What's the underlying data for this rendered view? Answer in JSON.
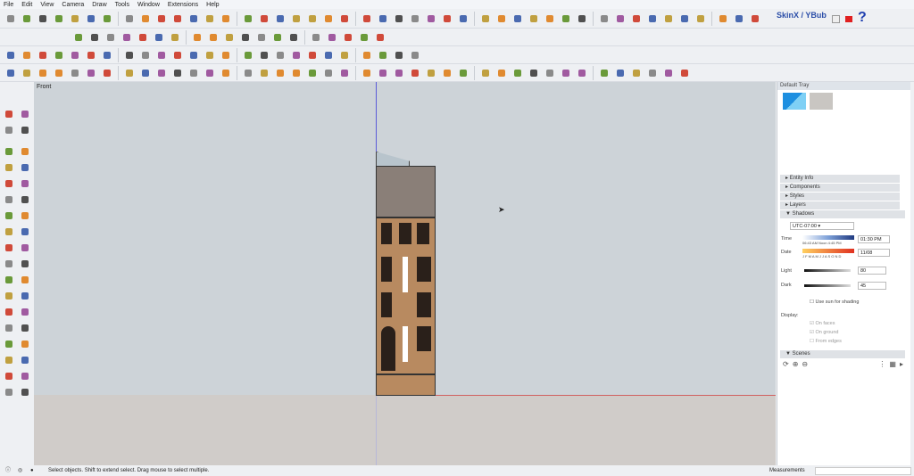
{
  "menu": [
    "File",
    "Edit",
    "View",
    "Camera",
    "Draw",
    "Tools",
    "Window",
    "Extensions",
    "Help"
  ],
  "toolbars": {
    "row1": [
      "orbit-icon",
      "play-icon",
      "stop-icon",
      "rewind-icon",
      "stamp-icon",
      "pushpin-icon",
      "drape-icon",
      "polyline-icon",
      "weld-icon",
      "scissors-icon",
      "cloud-icon",
      "cloud-icon",
      "curve-icon",
      "curve-icon",
      "curve-icon",
      "bezier-icon",
      "fillet-icon",
      "corner-icon",
      "arc-icon",
      "arc-icon",
      "chamfer-icon",
      "grid-icon",
      "grid-icon",
      "shape-icon",
      "shape-icon",
      "shape-icon",
      "shape-icon",
      "arrow-icon",
      "arrow-icon",
      "arrow-icon",
      "grid-icon",
      "grid-icon",
      "grid-icon",
      "grid-icon",
      "grid-icon",
      "grid-icon",
      "grid-icon",
      "grid-icon",
      "grid-icon",
      "grid-icon",
      "sphere-icon",
      "sphere-icon",
      "sphere-icon",
      "cloud-icon",
      "extrude-icon"
    ],
    "row2": [
      "extrude-icon",
      "extrude-icon",
      "extrude-icon",
      "extrude-icon",
      "extrude-icon",
      "extrude-icon",
      "extrude-icon",
      "extrude-icon",
      "wall-icon",
      "spline-icon",
      "tile-icon",
      "page-icon",
      "box-icon",
      "box-icon",
      "box-icon",
      "box-icon",
      "cup-icon",
      "lock-icon",
      "cloud-icon"
    ],
    "row3": [
      "select-icon",
      "component-icon",
      "paint-icon",
      "eraser-icon",
      "cube-icon",
      "cube-icon",
      "cube-icon",
      "shape-icon",
      "shape-icon",
      "shape-icon",
      "shape-icon",
      "shape-icon",
      "shape-icon",
      "shape-icon",
      "shape-icon",
      "shape-icon",
      "ridge-icon",
      "ridge-icon",
      "ridge-icon",
      "ridge-icon",
      "curve-icon",
      "knife-icon",
      "knife-icon",
      "knife-icon",
      "knife-icon"
    ],
    "row4": [
      "select-icon",
      "eraser-icon",
      "pencil-icon",
      "arc-icon",
      "rectangle-icon",
      "push-pull-icon",
      "follow-me-icon",
      "move-icon",
      "rotate-icon",
      "scale-icon",
      "tape-measure-icon",
      "text-icon",
      "paint-bucket-icon",
      "orbit-icon",
      "pan-icon",
      "zoom-icon",
      "zoom-extents-icon",
      "warehouse-icon",
      "warehouse-icon",
      "ruby-icon",
      "ruby-icon",
      "check-icon",
      "teapot-icon",
      "box-icon",
      "box-icon",
      "window-icon",
      "window-icon",
      "window-icon",
      "house-icon",
      "house-icon",
      "house-icon",
      "house-icon",
      "house-icon",
      "house-icon",
      "protractor-icon",
      "circle-icon",
      "protractor-icon",
      "protractor-icon",
      "sun-icon",
      "sun-icon",
      "sun-icon"
    ]
  },
  "brand": {
    "label": "SkinX / YBub"
  },
  "viewport": {
    "view_label": "Front",
    "sky": "#cdd3d8",
    "ground": "#d0ccc9"
  },
  "tray": {
    "title": "Default Tray",
    "panels": [
      "Entity Info",
      "Components",
      "Styles",
      "Layers"
    ],
    "shadows": {
      "title": "Shadows",
      "timezone": "UTC-07:00",
      "time_label": "Time",
      "time_ticks": "06:43 AM  Noon  4:45 PM",
      "time_value": "01:30 PM",
      "date_label": "Date",
      "months": "J F M A M J J A S O N D",
      "date_value": "11/08",
      "light_label": "Light",
      "light_value": "80",
      "dark_label": "Dark",
      "dark_value": "45",
      "use_sun": "Use sun for shading",
      "display_label": "Display:",
      "on_faces": "On faces",
      "on_ground": "On ground",
      "from_edges": "From edges"
    },
    "scenes": {
      "title": "Scenes"
    }
  },
  "status": {
    "message": "Select objects. Shift to extend select. Drag mouse to select multiple.",
    "measurements_label": "Measurements",
    "measurements_value": ""
  },
  "colors": {
    "axis_blue": "#3a3aff",
    "axis_red": "#d04040",
    "accent": "#2aa7e6"
  }
}
